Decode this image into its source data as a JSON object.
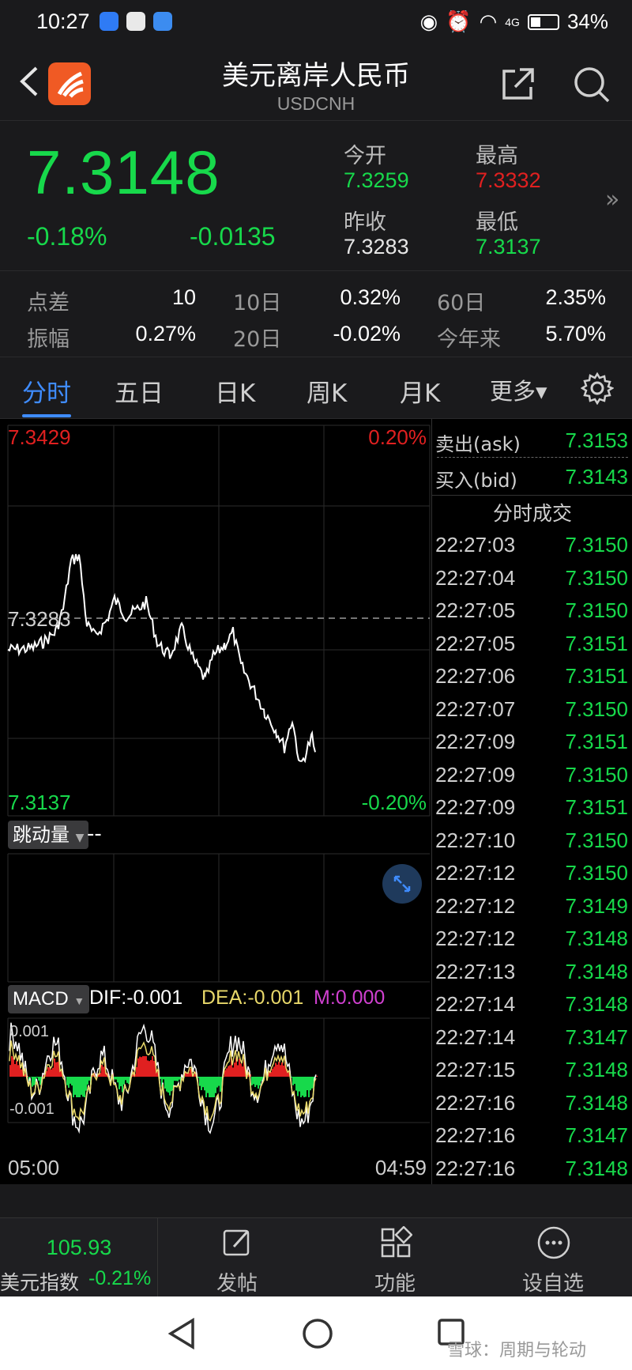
{
  "status_bar": {
    "time": "10:27",
    "battery": "34%",
    "signal": "4G"
  },
  "header": {
    "title": "美元离岸人民币",
    "subtitle": "USDCNH"
  },
  "quote": {
    "price": "7.3148",
    "change_pct": "-0.18%",
    "change_abs": "-0.0135",
    "open_label": "今开",
    "open_value": "7.3259",
    "high_label": "最高",
    "high_value": "7.3332",
    "prev_close_label": "昨收",
    "prev_close_value": "7.3283",
    "low_label": "最低",
    "low_value": "7.3137",
    "more_icon": "chevron-double-right-icon"
  },
  "stats": {
    "spread_label": "点差",
    "spread_value": "10",
    "d10_label": "10日",
    "d10_value": "0.32%",
    "d60_label": "60日",
    "d60_value": "2.35%",
    "amplitude_label": "振幅",
    "amplitude_value": "0.27%",
    "d20_label": "20日",
    "d20_value": "-0.02%",
    "ytd_label": "今年来",
    "ytd_value": "5.70%"
  },
  "tabs": {
    "t1": "分时",
    "t2": "五日",
    "t3": "日K",
    "t4": "周K",
    "t5": "月K",
    "t6": "更多▾"
  },
  "chart": {
    "max_price": "7.3429",
    "max_pct": "0.20%",
    "mid_price": "7.3283",
    "min_price": "7.3137",
    "min_pct": "-0.20%",
    "volume_label": "跳动量",
    "volume_value": "--",
    "macd_label": "MACD",
    "dif": "DIF:-0.001",
    "dea": "DEA:-0.001",
    "m": "M:0.000",
    "macd_top": "0.001",
    "macd_bottom": "-0.001",
    "time_start": "05:00",
    "time_end": "04:59",
    "colors": {
      "up": "#e02020",
      "down": "#17d94b",
      "line": "#ffffff",
      "accent": "#3f8cff"
    }
  },
  "side": {
    "ask_label": "卖出(ask)",
    "ask_value": "7.3153",
    "bid_label": "买入(bid)",
    "bid_value": "7.3143",
    "ticks_title": "分时成交",
    "ticks": [
      {
        "t": "22:27:03",
        "p": "7.3150"
      },
      {
        "t": "22:27:04",
        "p": "7.3150"
      },
      {
        "t": "22:27:05",
        "p": "7.3150"
      },
      {
        "t": "22:27:05",
        "p": "7.3151"
      },
      {
        "t": "22:27:06",
        "p": "7.3151"
      },
      {
        "t": "22:27:07",
        "p": "7.3150"
      },
      {
        "t": "22:27:09",
        "p": "7.3151"
      },
      {
        "t": "22:27:09",
        "p": "7.3150"
      },
      {
        "t": "22:27:09",
        "p": "7.3151"
      },
      {
        "t": "22:27:10",
        "p": "7.3150"
      },
      {
        "t": "22:27:12",
        "p": "7.3150"
      },
      {
        "t": "22:27:12",
        "p": "7.3149"
      },
      {
        "t": "22:27:12",
        "p": "7.3148"
      },
      {
        "t": "22:27:13",
        "p": "7.3148"
      },
      {
        "t": "22:27:14",
        "p": "7.3148"
      },
      {
        "t": "22:27:14",
        "p": "7.3147"
      },
      {
        "t": "22:27:15",
        "p": "7.3148"
      },
      {
        "t": "22:27:16",
        "p": "7.3148"
      },
      {
        "t": "22:27:16",
        "p": "7.3147"
      },
      {
        "t": "22:27:16",
        "p": "7.3148"
      }
    ]
  },
  "bottom_nav": {
    "index_value": "105.93",
    "index_label": "美元指数",
    "index_change": "-0.21%",
    "post_label": "发帖",
    "func_label": "功能",
    "watch_label": "设自选"
  },
  "watermark": "雪球：周期与轮动"
}
